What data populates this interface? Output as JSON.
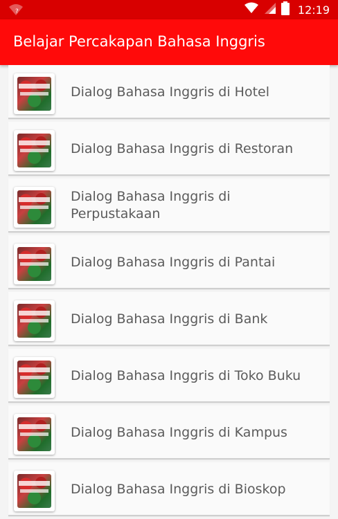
{
  "status_bar": {
    "time": "12:19",
    "icons": [
      "wifi-question-icon",
      "wifi-x-icon",
      "signal-icon",
      "battery-icon"
    ]
  },
  "app_bar": {
    "title": "Belajar Percakapan Bahasa Inggris",
    "color": "#ff0a0a"
  },
  "list": {
    "items": [
      {
        "label": "Dialog Bahasa Inggris di Hotel",
        "icon": "app-thumbnail"
      },
      {
        "label": "Dialog Bahasa Inggris di Restoran",
        "icon": "app-thumbnail"
      },
      {
        "label": "Dialog Bahasa Inggris di Perpustakaan",
        "icon": "app-thumbnail"
      },
      {
        "label": "Dialog Bahasa Inggris di Pantai",
        "icon": "app-thumbnail"
      },
      {
        "label": "Dialog Bahasa Inggris di Bank",
        "icon": "app-thumbnail"
      },
      {
        "label": "Dialog Bahasa Inggris di Toko Buku",
        "icon": "app-thumbnail"
      },
      {
        "label": "Dialog Bahasa Inggris di Kampus",
        "icon": "app-thumbnail"
      },
      {
        "label": "Dialog Bahasa Inggris di Bioskop",
        "icon": "app-thumbnail"
      }
    ]
  }
}
